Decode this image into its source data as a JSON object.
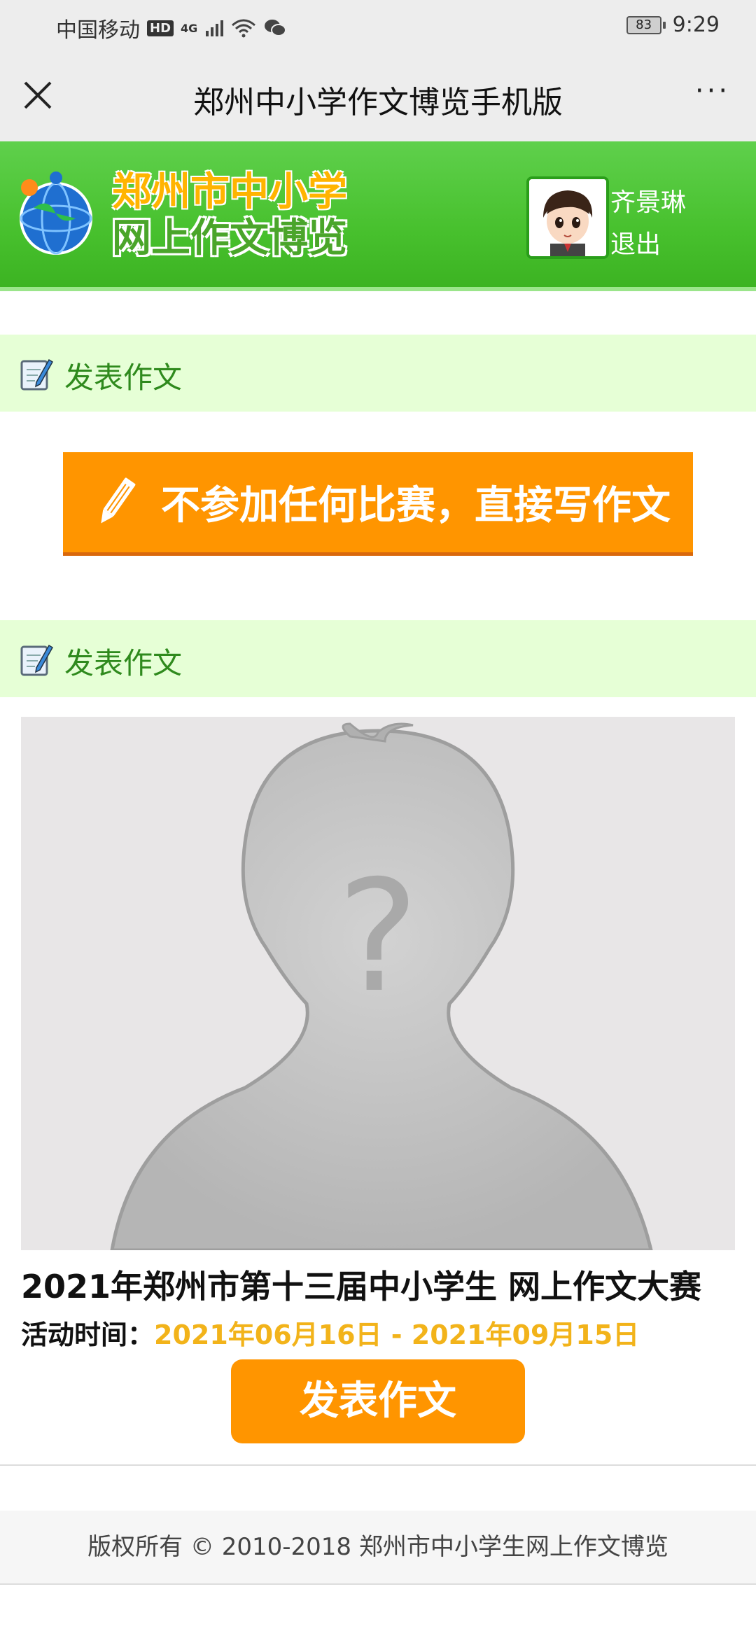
{
  "status_bar": {
    "carrier": "中国移动",
    "hd_badge": "HD",
    "network": "4G",
    "battery": "83",
    "time": "9:29"
  },
  "title_bar": {
    "title": "郑州中小学作文博览手机版",
    "close_icon": "close-icon",
    "more_icon": "more-icon",
    "more_glyph": "···"
  },
  "banner": {
    "logo_line1": "郑州市中小学",
    "logo_line2": "网上作文博览",
    "user_name": "齐景琳",
    "logout": "退出"
  },
  "section1": {
    "label": "发表作文"
  },
  "direct_write_button": {
    "label": "不参加任何比赛，直接写作文"
  },
  "section2": {
    "label": "发表作文"
  },
  "contest": {
    "title": "2021年郑州市第十三届中小学生 网上作文大赛",
    "time_label": "活动时间：",
    "time_value": "2021年06月16日 - 2021年09月15日",
    "submit_label": "发表作文"
  },
  "footer": {
    "text": "版权所有 © 2010-2018 郑州市中小学生网上作文博览"
  },
  "colors": {
    "accent_orange": "#ff9500",
    "banner_green": "#48c12e",
    "section_bg": "#e6ffd6",
    "section_text": "#2f8a1d",
    "date_yellow": "#f2b31a"
  }
}
